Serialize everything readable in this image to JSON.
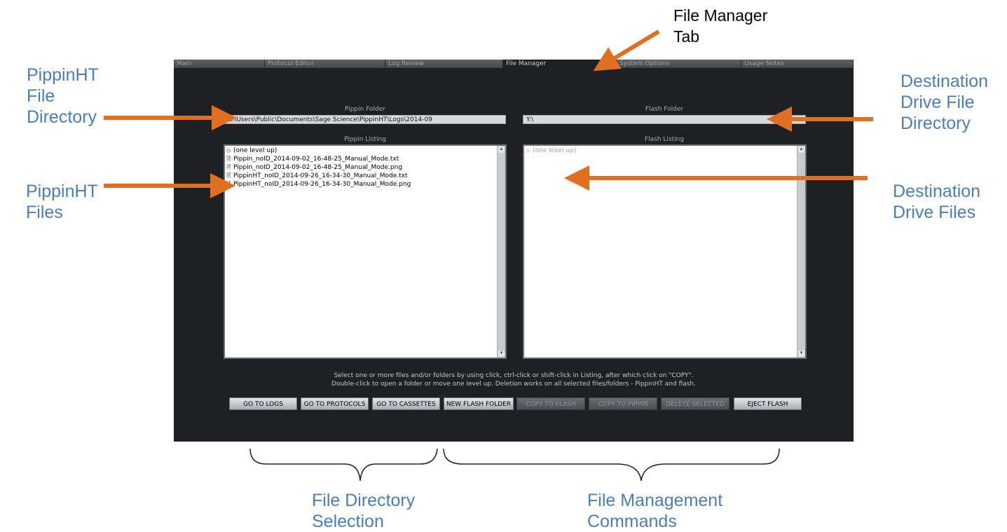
{
  "callouts": {
    "file_manager_tab": "File Manager\nTab",
    "pippinht_file_directory": "PippinHT\nFile\nDirectory",
    "pippinht_files": "PippinHT\nFiles",
    "destination_drive_file_directory": "Destination\nDrive File\nDirectory",
    "destination_drive_files": "Destination\nDrive Files",
    "file_directory_selection": "File Directory\nSelection",
    "file_management_commands": "File Management\nCommands"
  },
  "tabs": [
    {
      "label": "Main"
    },
    {
      "label": "Protocol Editor"
    },
    {
      "label": "Log Review"
    },
    {
      "label": "File Manager",
      "active": true
    },
    {
      "label": "System Options"
    },
    {
      "label": "Usage Notes"
    }
  ],
  "pippin": {
    "folder_label": "Pippin Folder",
    "folder_path": "C:\\Users\\Public\\Documents\\Sage Science\\PippinHT\\Logs\\2014-09",
    "listing_label": "Pippin Listing",
    "items": [
      {
        "icon": "◇",
        "name": "(one level up)"
      },
      {
        "icon": "🗎",
        "name": "Pippin_noID_2014-09-02_16-48-25_Manual_Mode.txt"
      },
      {
        "icon": "🗎",
        "name": "Pippin_noID_2014-09-02_16-48-25_Manual_Mode.png"
      },
      {
        "icon": "🗎",
        "name": "PippinHT_noID_2014-09-26_16-34-30_Manual_Mode.txt"
      },
      {
        "icon": "🗎",
        "name": "PippinHT_noID_2014-09-26_16-34-30_Manual_Mode.png"
      }
    ]
  },
  "flash": {
    "folder_label": "Flash Folder",
    "folder_path": "Y:\\",
    "listing_label": "Flash Listing",
    "items": [
      {
        "icon": "◇",
        "name": "(one level up)"
      }
    ]
  },
  "help_text": {
    "line1": "Select one or more files and/or folders by using click, ctrl-click or shift-click in Listing, after which click on \"COPY\".",
    "line2": "Double-click to open a folder or move one level up. Deletion works on all selected files/folders - PippinHT and flash."
  },
  "buttons": {
    "go_to_logs": "GO TO LOGS",
    "go_to_protocols": "GO TO PROTOCOLS",
    "go_to_cassettes": "GO TO CASSETTES",
    "new_flash_folder": "NEW FLASH FOLDER",
    "copy_to_flash": "COPY TO FLASH",
    "copy_to_pippin": "COPY TO PIPPIN",
    "delete_selected": "DELETE SELECTED",
    "eject_flash": "EJECT FLASH"
  },
  "colors": {
    "callout_text": "#4a7ebb",
    "arrow": "#e07020",
    "app_background": "#1f2023"
  }
}
